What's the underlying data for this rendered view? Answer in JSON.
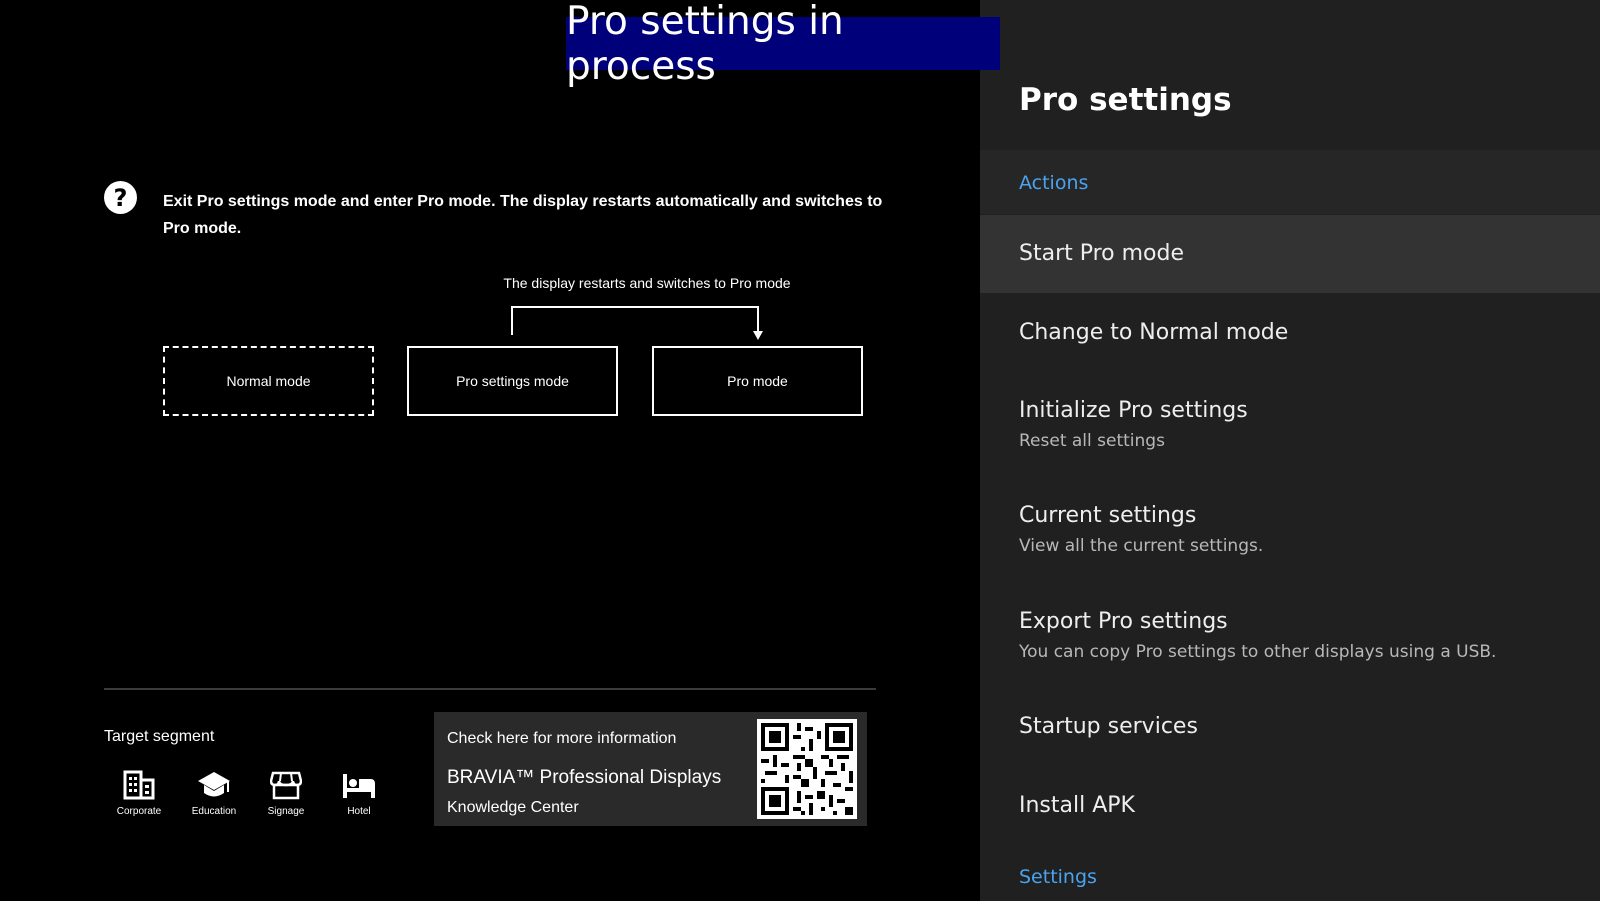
{
  "banner": {
    "text": "Pro settings in process"
  },
  "help": {
    "text": "Exit Pro settings mode and enter Pro mode. The display restarts automatically and switches to Pro mode."
  },
  "diagram": {
    "caption": "The display restarts and switches to Pro mode",
    "modes": [
      "Normal mode",
      "Pro settings mode",
      "Pro mode"
    ]
  },
  "target_segment": {
    "label": "Target segment",
    "items": [
      {
        "label": "Corporate",
        "icon": "building-icon"
      },
      {
        "label": "Education",
        "icon": "graduation-cap-icon"
      },
      {
        "label": "Signage",
        "icon": "storefront-icon"
      },
      {
        "label": "Hotel",
        "icon": "bed-icon"
      }
    ]
  },
  "info": {
    "check": "Check here for more information",
    "brand": "BRAVIA™ Professional Displays",
    "knowledge": "Knowledge Center",
    "qr_icon": "qr-code-icon"
  },
  "panel": {
    "title": "Pro settings",
    "actions_header": "Actions",
    "settings_header": "Settings",
    "items": [
      {
        "title": "Start Pro mode",
        "subtitle": "",
        "selected": true
      },
      {
        "title": "Change to Normal mode",
        "subtitle": ""
      },
      {
        "title": "Initialize Pro settings",
        "subtitle": "Reset all settings"
      },
      {
        "title": "Current settings",
        "subtitle": "View all the current settings."
      },
      {
        "title": "Export Pro settings",
        "subtitle": "You can copy Pro settings to other displays using a USB."
      },
      {
        "title": "Startup services",
        "subtitle": ""
      },
      {
        "title": "Install APK",
        "subtitle": ""
      }
    ]
  },
  "colors": {
    "accent": "#4aa3f0",
    "banner": "#00007a",
    "panel": "#202020"
  }
}
